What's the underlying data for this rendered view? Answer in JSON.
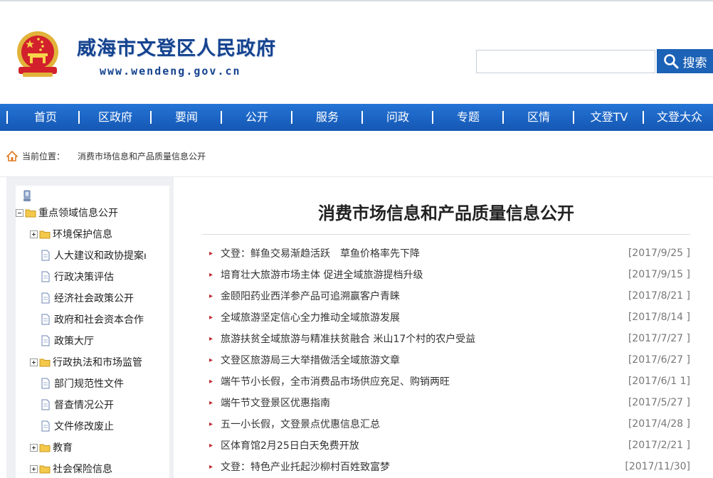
{
  "header": {
    "site_title": "威海市文登区人民政府",
    "site_url": "www.wendeng.gov.cn",
    "search_placeholder": "",
    "search_label": "搜索"
  },
  "nav": [
    "首页",
    "区政府",
    "要闻",
    "公开",
    "服务",
    "问政",
    "专题",
    "区情",
    "文登TV",
    "文登大众"
  ],
  "breadcrumb": {
    "label": "当前位置：",
    "current": "消费市场信息和产品质量信息公开"
  },
  "sidebar": {
    "root_label": "重点领域信息公开",
    "items": [
      {
        "label": "环境保护信息",
        "type": "folder"
      },
      {
        "label": "人大建议和政协提案ו",
        "type": "doc"
      },
      {
        "label": "行政决策评估",
        "type": "doc"
      },
      {
        "label": "经济社会政策公开",
        "type": "doc"
      },
      {
        "label": "政府和社会资本合作",
        "type": "doc"
      },
      {
        "label": "政策大厅",
        "type": "doc"
      },
      {
        "label": "行政执法和市场监管",
        "type": "folder"
      },
      {
        "label": "部门规范性文件",
        "type": "doc"
      },
      {
        "label": "督查情况公开",
        "type": "doc"
      },
      {
        "label": "文件修改废止",
        "type": "doc"
      },
      {
        "label": "教育",
        "type": "folder"
      },
      {
        "label": "社会保险信息",
        "type": "folder"
      }
    ]
  },
  "content": {
    "title": "消费市场信息和产品质量信息公开",
    "news": [
      {
        "title": "文登：鲜鱼交易渐趋活跃　草鱼价格率先下降",
        "date": "[2017/9/25 ]"
      },
      {
        "title": "培育壮大旅游市场主体 促进全域旅游提档升级",
        "date": "[2017/9/15 ]"
      },
      {
        "title": "金颐阳药业西洋参产品可追溯赢客户青睐",
        "date": "[2017/8/21 ]"
      },
      {
        "title": "全域旅游坚定信心全力推动全域旅游发展",
        "date": "[2017/8/14 ]"
      },
      {
        "title": "旅游扶贫全域旅游与精准扶贫融合 米山17个村的农户受益",
        "date": "[2017/7/27 ]"
      },
      {
        "title": "文登区旅游局三大举措做活全域旅游文章",
        "date": "[2017/6/27 ]"
      },
      {
        "title": "端午节小长假，全市消费品市场供应充足、购销两旺",
        "date": "[2017/6/1 1]"
      },
      {
        "title": "端午节文登景区优惠指南",
        "date": "[2017/5/27 ]"
      },
      {
        "title": "五一小长假，文登景点优惠信息汇总",
        "date": "[2017/4/28 ]"
      },
      {
        "title": "区体育馆2月25日白天免费开放",
        "date": "[2017/2/21 ]"
      },
      {
        "title": "文登：特色产业托起沙柳村百姓致富梦",
        "date": "[2017/11/30]"
      }
    ]
  }
}
